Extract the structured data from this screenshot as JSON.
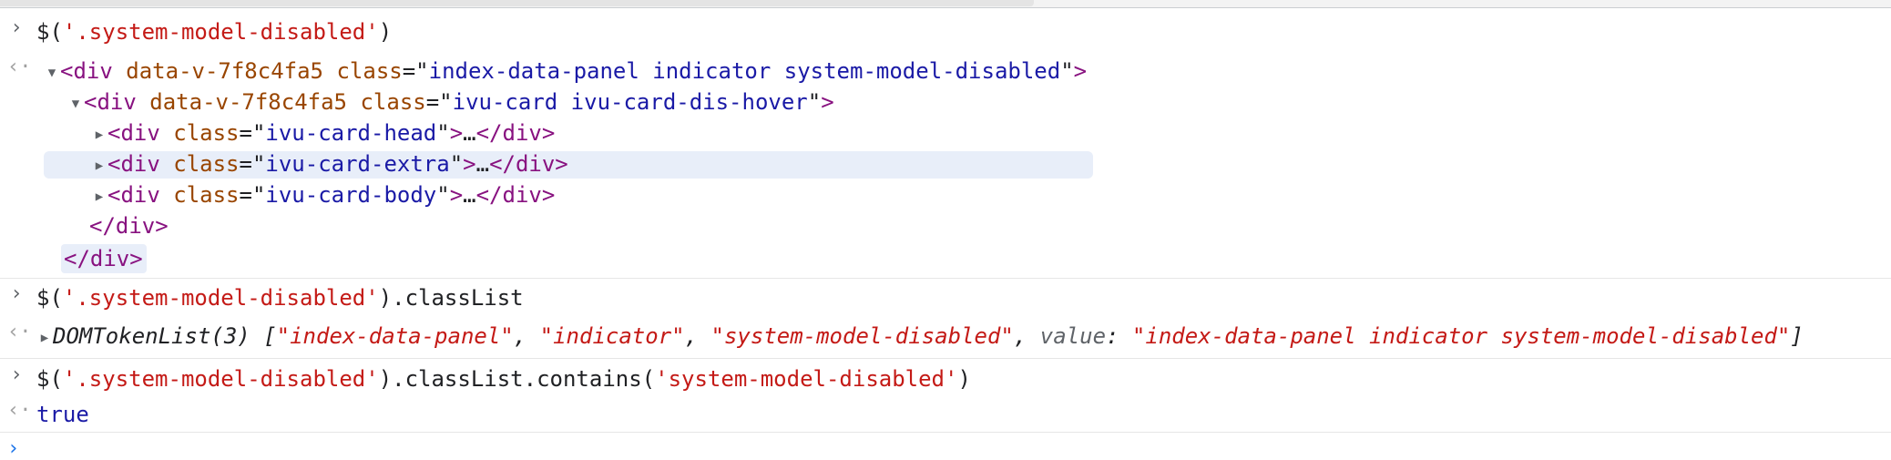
{
  "console": {
    "prompt_glyph": "›",
    "result_glyph": "‹·",
    "entries": [
      {
        "command": {
          "fn": "$(",
          "arg": "'.system-model-disabled'",
          "close": ")"
        },
        "dom": {
          "root_open": {
            "tag": "div",
            "attr1": "data-v-7f8c4fa5",
            "class_attr": "class",
            "class_val": "index-data-panel indicator system-model-disabled"
          },
          "child_open": {
            "tag": "div",
            "attr1": "data-v-7f8c4fa5",
            "class_attr": "class",
            "class_val": "ivu-card ivu-card-dis-hover"
          },
          "children": [
            {
              "class_val": "ivu-card-head"
            },
            {
              "class_val": "ivu-card-extra"
            },
            {
              "class_val": "ivu-card-body"
            }
          ],
          "ellipsis": "…",
          "child_close": "</div>",
          "root_close": "</div>"
        }
      },
      {
        "command": {
          "fn": "$(",
          "arg": "'.system-model-disabled'",
          "close": ").classList"
        },
        "result": {
          "type_name": "DOMTokenList(3)",
          "items": [
            "\"index-data-panel\"",
            "\"indicator\"",
            "\"system-model-disabled\""
          ],
          "value_key": "value",
          "value_val": "\"index-data-panel indicator system-model-disabled\""
        }
      },
      {
        "command": {
          "fn": "$(",
          "arg": "'.system-model-disabled'",
          "mid": ").classList.contains(",
          "arg2": "'system-model-disabled'",
          "close": ")"
        },
        "result": {
          "text": "true"
        }
      }
    ]
  }
}
